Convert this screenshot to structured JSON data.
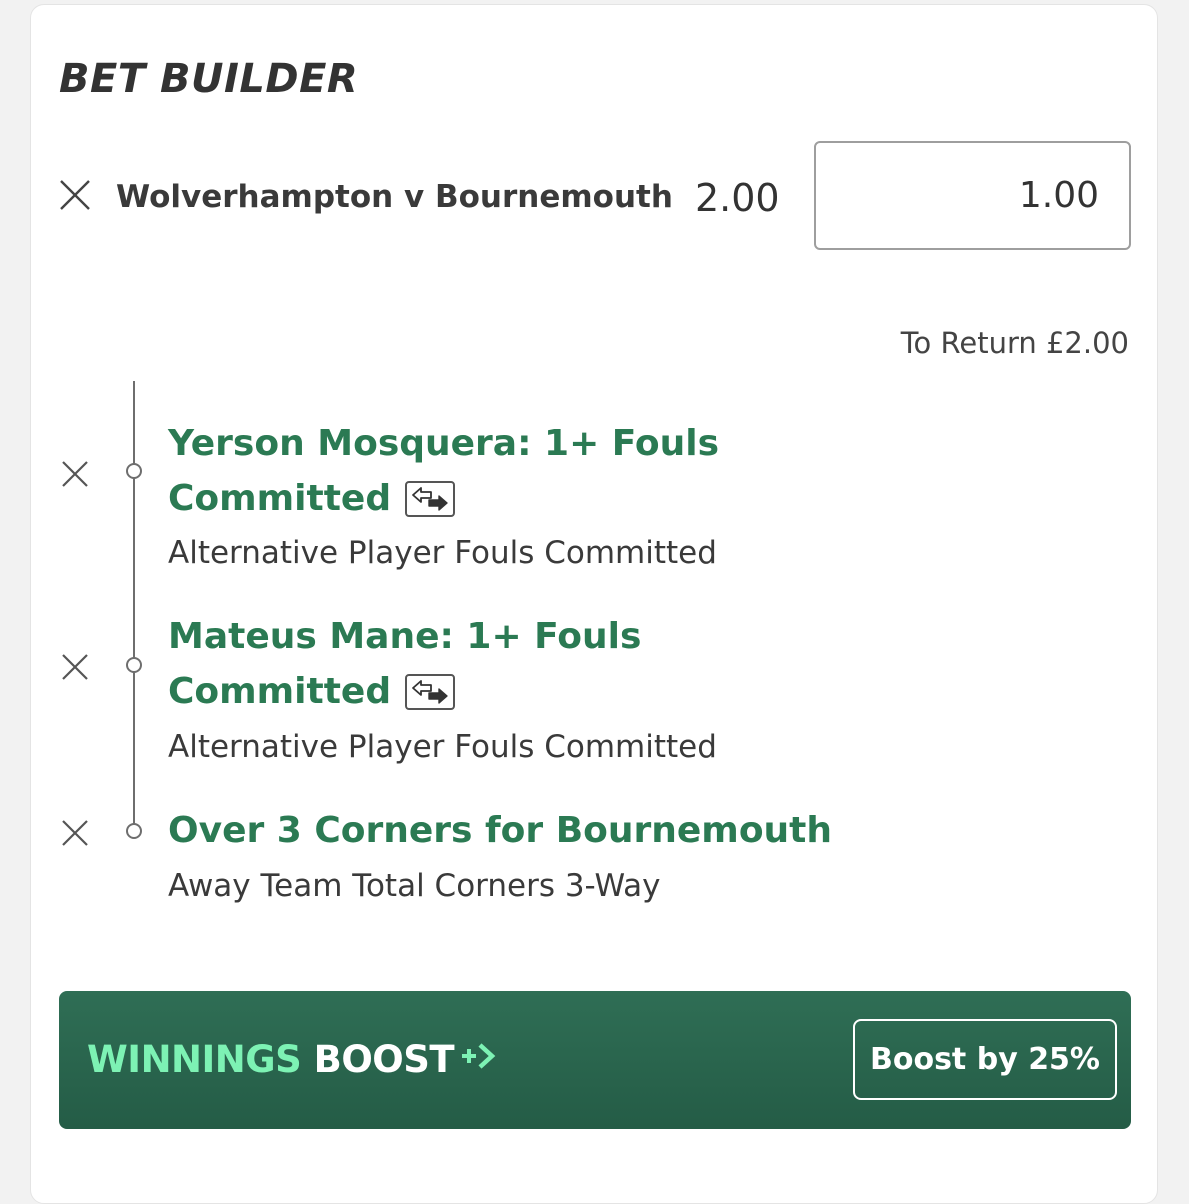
{
  "header": {
    "title": "BET BUILDER"
  },
  "bet": {
    "match": "Wolverhampton v Bournemouth",
    "odds": "2.00",
    "stake": "1.00",
    "to_return": "To Return £2.00"
  },
  "selections": [
    {
      "title_line1": "Yerson Mosquera: 1+ Fouls",
      "title_line2": "Committed",
      "market": "Alternative Player Fouls Committed"
    },
    {
      "title_line1": "Mateus Mane: 1+ Fouls",
      "title_line2": "Committed",
      "market": "Alternative Player Fouls Committed"
    },
    {
      "title_line1": "Over 3 Corners for Bournemouth",
      "market": "Away Team Total Corners 3-Way"
    }
  ],
  "boost": {
    "label_highlight": "WINNINGS",
    "label_rest": "BOOST",
    "button": "Boost by 25%"
  },
  "colors": {
    "selection_green": "#2b7a53",
    "boost_bg": "#2a6650",
    "boost_highlight": "#7df2b4"
  },
  "icons": [
    "close-icon",
    "swap-icon",
    "boost-arrow-icon"
  ]
}
